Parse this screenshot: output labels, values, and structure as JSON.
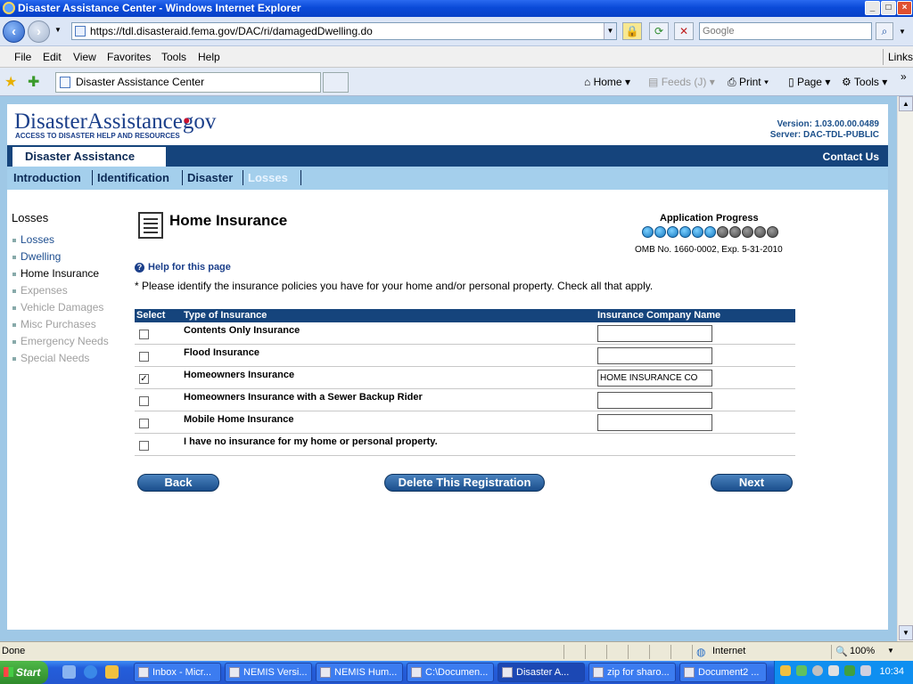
{
  "window": {
    "title": "Disaster Assistance Center - Windows Internet Explorer"
  },
  "browser": {
    "url": "https://tdl.disasteraid.fema.gov/DAC/ri/damagedDwelling.do",
    "search_placeholder": "Google",
    "menu": [
      "File",
      "Edit",
      "View",
      "Favorites",
      "Tools",
      "Help"
    ],
    "links_label": "Links",
    "tab_title": "Disaster Assistance Center",
    "commands": {
      "home": "Home",
      "feeds": "Feeds (J)",
      "print": "Print",
      "page": "Page",
      "tools": "Tools"
    }
  },
  "site": {
    "logo_main": "DisasterAssistance",
    "logo_dot": "•",
    "logo_gov": "gov",
    "tagline": "ACCESS TO DISASTER HELP AND RESOURCES",
    "version": "Version: 1.03.00.00.0489",
    "server": "Server: DAC-TDL-PUBLIC",
    "section_tab": "Disaster Assistance",
    "contact": "Contact Us",
    "nav_tabs": [
      "Introduction",
      "Identification",
      "Disaster",
      "Losses"
    ]
  },
  "left_nav": {
    "title": "Losses",
    "items": [
      {
        "label": "Losses",
        "state": "link"
      },
      {
        "label": "Dwelling",
        "state": "link"
      },
      {
        "label": "Home Insurance",
        "state": "current"
      },
      {
        "label": "Expenses",
        "state": "disabled"
      },
      {
        "label": "Vehicle Damages",
        "state": "disabled"
      },
      {
        "label": "Misc Purchases",
        "state": "disabled"
      },
      {
        "label": "Emergency Needs",
        "state": "disabled"
      },
      {
        "label": "Special Needs",
        "state": "disabled"
      }
    ]
  },
  "main": {
    "heading": "Home Insurance",
    "progress_title": "Application Progress",
    "progress": {
      "completed": 6,
      "total": 11
    },
    "omb": "OMB No. 1660-0002, Exp. 5-31-2010",
    "help_link": "Help for this page",
    "instruction": "* Please identify the insurance policies you have for your home and/or personal property. Check all that apply.",
    "table": {
      "headers": [
        "Select",
        "Type of Insurance",
        "Insurance Company Name"
      ],
      "rows": [
        {
          "type": "Contents Only Insurance",
          "checked": false,
          "company": ""
        },
        {
          "type": "Flood Insurance",
          "checked": false,
          "company": ""
        },
        {
          "type": "Homeowners Insurance",
          "checked": true,
          "company": "HOME INSURANCE CO"
        },
        {
          "type": "Homeowners Insurance with a Sewer Backup Rider",
          "checked": false,
          "company": ""
        },
        {
          "type": "Mobile Home Insurance",
          "checked": false,
          "company": ""
        },
        {
          "type": "I have no insurance for my home or personal property.",
          "checked": false,
          "company": null
        }
      ]
    },
    "buttons": {
      "back": "Back",
      "delete": "Delete This Registration",
      "next": "Next"
    }
  },
  "statusbar": {
    "status": "Done",
    "zone": "Internet",
    "zoom": "100%"
  },
  "taskbar": {
    "start": "Start",
    "tasks": [
      "Inbox - Micr...",
      "NEMIS Versi...",
      "NEMIS Hum...",
      "C:\\Documen...",
      "Disaster A...",
      "zip for sharo...",
      "Document2 ..."
    ],
    "clock": "10:34"
  }
}
